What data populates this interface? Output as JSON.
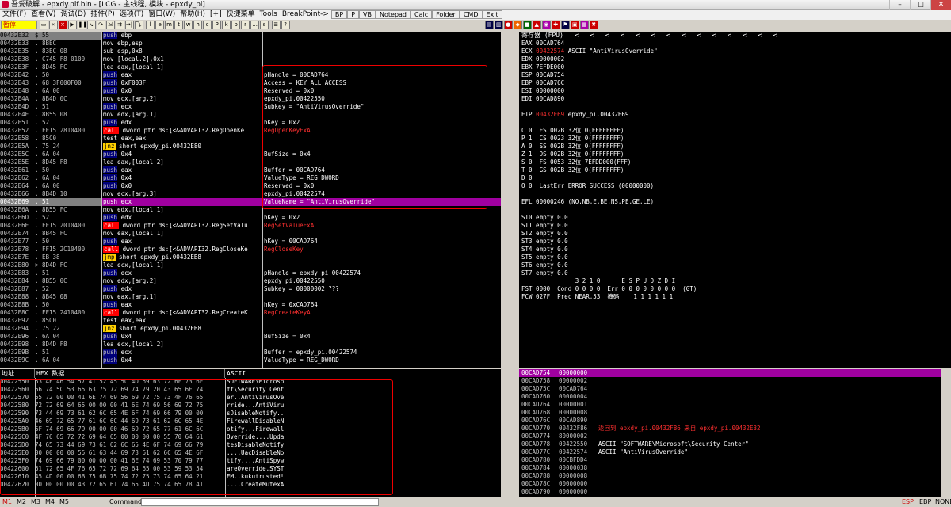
{
  "window": {
    "title": "吾爱破解 - epxdy.pif.bin - [LCG - 主线程, 模块 - epxdy_pi]",
    "min": "–",
    "max": "□",
    "close": "✕"
  },
  "menu": [
    "文件(F)",
    "查看(V)",
    "调试(D)",
    "插件(P)",
    "选项(T)",
    "窗口(W)",
    "帮助(H)",
    "[+]",
    "快捷菜单",
    "Tools",
    "BreakPoint->",
    "BP",
    "P",
    "VB",
    "Notepad",
    "Calc",
    "Folder",
    "CMD",
    "Exit"
  ],
  "toolbar": {
    "status": "暂停",
    "letters": [
      "l",
      "e",
      "m",
      "t",
      "w",
      "h",
      "c",
      "P",
      "k",
      "b",
      "r",
      "...",
      "s"
    ]
  },
  "cpu_rows": [
    {
      "addr": "00432E32",
      "mark": "$",
      "hex": "55",
      "op": "push",
      "arg": " ebp",
      "cmt": ""
    },
    {
      "addr": "00432E33",
      "mark": ".",
      "hex": "8BEC",
      "op": "mov",
      "arg": " ebp,esp",
      "cmt": ""
    },
    {
      "addr": "00432E35",
      "mark": ".",
      "hex": "83EC 08",
      "op": "sub",
      "arg": " esp,0x8",
      "cmt": ""
    },
    {
      "addr": "00432E38",
      "mark": ".",
      "hex": "C745 F8 0100",
      "op": "mov",
      "arg": " [local.2],0x1",
      "cmt": ""
    },
    {
      "addr": "00432E3F",
      "mark": ".",
      "hex": "8D45 FC",
      "op": "lea",
      "arg": " eax,[local.1]",
      "cmt": ""
    },
    {
      "addr": "00432E42",
      "mark": ".",
      "hex": "50",
      "op": "push",
      "arg": " eax",
      "cmt": "pHandle = 00CAD764"
    },
    {
      "addr": "00432E43",
      "mark": ".",
      "hex": "68 3F000F00",
      "op": "push",
      "arg": " 0xF003F",
      "cmt": "Access = KEY_ALL_ACCESS"
    },
    {
      "addr": "00432E48",
      "mark": ".",
      "hex": "6A 00",
      "op": "push",
      "arg": " 0x0",
      "cmt": "Reserved = 0x0"
    },
    {
      "addr": "00432E4A",
      "mark": ".",
      "hex": "8B4D 0C",
      "op": "mov",
      "arg": " ecx,[arg.2]",
      "cmt": "epxdy_pi.00422550"
    },
    {
      "addr": "00432E4D",
      "mark": ".",
      "hex": "51",
      "op": "push",
      "arg": " ecx",
      "cmt": "Subkey = \"AntiVirusOverride\""
    },
    {
      "addr": "00432E4E",
      "mark": ".",
      "hex": "8B55 08",
      "op": "mov",
      "arg": " edx,[arg.1]",
      "cmt": ""
    },
    {
      "addr": "00432E51",
      "mark": ".",
      "hex": "52",
      "op": "push",
      "arg": " edx",
      "cmt": "hKey = 0x2"
    },
    {
      "addr": "00432E52",
      "mark": ".",
      "hex": "FF15 2810400",
      "op": "call",
      "arg": " dword ptr ds:[<&ADVAPI32.RegOpenKe",
      "cmt": "RegOpenKeyExA"
    },
    {
      "addr": "00432E58",
      "mark": ".",
      "hex": "85C0",
      "op": "test",
      "arg": " eax,eax",
      "cmt": ""
    },
    {
      "addr": "00432E5A",
      "mark": ".",
      "hex": "75 24",
      "op": "jnz",
      "arg": " short epxdy_pi.00432E80",
      "cmt": ""
    },
    {
      "addr": "00432E5C",
      "mark": ".",
      "hex": "6A 04",
      "op": "push",
      "arg": " 0x4",
      "cmt": "BufSize = 0x4"
    },
    {
      "addr": "00432E5E",
      "mark": ".",
      "hex": "8D45 F8",
      "op": "lea",
      "arg": " eax,[local.2]",
      "cmt": ""
    },
    {
      "addr": "00432E61",
      "mark": ".",
      "hex": "50",
      "op": "push",
      "arg": " eax",
      "cmt": "Buffer = 00CAD764"
    },
    {
      "addr": "00432E62",
      "mark": ".",
      "hex": "6A 04",
      "op": "push",
      "arg": " 0x4",
      "cmt": "ValueType = REG_DWORD"
    },
    {
      "addr": "00432E64",
      "mark": ".",
      "hex": "6A 00",
      "op": "push",
      "arg": " 0x0",
      "cmt": "Reserved = 0x0"
    },
    {
      "addr": "00432E66",
      "mark": ".",
      "hex": "8B4D 10",
      "op": "mov",
      "arg": " ecx,[arg.3]",
      "cmt": "epxdy_pi.00422574"
    },
    {
      "addr": "00432E69",
      "mark": ".",
      "hex": "51",
      "op": "push",
      "arg": " ecx",
      "cmt": "ValueName = \"AntiVirusOverride\"",
      "hl": true
    },
    {
      "addr": "00432E6A",
      "mark": ".",
      "hex": "8B55 FC",
      "op": "mov",
      "arg": " edx,[local.1]",
      "cmt": ""
    },
    {
      "addr": "00432E6D",
      "mark": ".",
      "hex": "52",
      "op": "push",
      "arg": " edx",
      "cmt": "hKey = 0x2"
    },
    {
      "addr": "00432E6E",
      "mark": ".",
      "hex": "FF15 2010400",
      "op": "call",
      "arg": " dword ptr ds:[<&ADVAPI32.RegSetValu",
      "cmt": "RegSetValueExA"
    },
    {
      "addr": "00432E74",
      "mark": ".",
      "hex": "8B45 FC",
      "op": "mov",
      "arg": " eax,[local.1]",
      "cmt": ""
    },
    {
      "addr": "00432E77",
      "mark": ".",
      "hex": "50",
      "op": "push",
      "arg": " eax",
      "cmt": "hKey = 00CAD764"
    },
    {
      "addr": "00432E78",
      "mark": ".",
      "hex": "FF15 2C10400",
      "op": "call",
      "arg": " dword ptr ds:[<&ADVAPI32.RegCloseKe",
      "cmt": "RegCloseKey"
    },
    {
      "addr": "00432E7E",
      "mark": ".",
      "hex": "EB 38",
      "op": "jmp",
      "arg": " short epxdy_pi.00432EB8",
      "cmt": ""
    },
    {
      "addr": "00432E80",
      "mark": ">",
      "hex": "8D4D FC",
      "op": "lea",
      "arg": " ecx,[local.1]",
      "cmt": ""
    },
    {
      "addr": "00432E83",
      "mark": ".",
      "hex": "51",
      "op": "push",
      "arg": " ecx",
      "cmt": "pHandle = epxdy_pi.00422574"
    },
    {
      "addr": "00432E84",
      "mark": ".",
      "hex": "8B55 0C",
      "op": "mov",
      "arg": " edx,[arg.2]",
      "cmt": "epxdy_pi.00422550"
    },
    {
      "addr": "00432E87",
      "mark": ".",
      "hex": "52",
      "op": "push",
      "arg": " edx",
      "cmt": "Subkey = 00000002 ???"
    },
    {
      "addr": "00432E88",
      "mark": ".",
      "hex": "8B45 08",
      "op": "mov",
      "arg": " eax,[arg.1]",
      "cmt": ""
    },
    {
      "addr": "00432E8B",
      "mark": ".",
      "hex": "50",
      "op": "push",
      "arg": " eax",
      "cmt": "hKey = 0xCAD764"
    },
    {
      "addr": "00432E8C",
      "mark": ".",
      "hex": "FF15 2410400",
      "op": "call",
      "arg": " dword ptr ds:[<&ADVAPI32.RegCreateK",
      "cmt": "RegCreateKeyA"
    },
    {
      "addr": "00432E92",
      "mark": ".",
      "hex": "85C0",
      "op": "test",
      "arg": " eax,eax",
      "cmt": ""
    },
    {
      "addr": "00432E94",
      "mark": ".",
      "hex": "75 22",
      "op": "jnz",
      "arg": " short epxdy_pi.00432EB8",
      "cmt": ""
    },
    {
      "addr": "00432E96",
      "mark": ".",
      "hex": "6A 04",
      "op": "push",
      "arg": " 0x4",
      "cmt": "BufSize = 0x4"
    },
    {
      "addr": "00432E98",
      "mark": ".",
      "hex": "8D4D F8",
      "op": "lea",
      "arg": " ecx,[local.2]",
      "cmt": ""
    },
    {
      "addr": "00432E9B",
      "mark": ".",
      "hex": "51",
      "op": "push",
      "arg": " ecx",
      "cmt": "Buffer = epxdy_pi.00422574"
    },
    {
      "addr": "00432E9C",
      "mark": ".",
      "hex": "6A 04",
      "op": "push",
      "arg": " 0x4",
      "cmt": "ValueType = REG_DWORD"
    }
  ],
  "registers": {
    "header": "寄存器 (FPU)",
    "lines": [
      [
        "EAX 00CAD764",
        ""
      ],
      [
        "ECX ",
        "00422574",
        " ASCII \"AntiVirusOverride\""
      ],
      [
        "EDX 00000002",
        ""
      ],
      [
        "EBX 7EFDE000",
        ""
      ],
      [
        "ESP 00CAD754",
        ""
      ],
      [
        "EBP 00CAD76C",
        ""
      ],
      [
        "ESI 00000000",
        ""
      ],
      [
        "EDI 00CAD890",
        ""
      ],
      [
        "",
        ""
      ],
      [
        "EIP ",
        "00432E69",
        " epxdy_pi.00432E69"
      ],
      [
        "",
        ""
      ],
      [
        "C 0  ES 002B 32位 0(FFFFFFFF)",
        ""
      ],
      [
        "P 1  CS 0023 32位 0(FFFFFFFF)",
        ""
      ],
      [
        "A 0  SS 002B 32位 0(FFFFFFFF)",
        ""
      ],
      [
        "Z 1  DS 002B 32位 0(FFFFFFFF)",
        ""
      ],
      [
        "S 0  FS 0053 32位 7EFDD000(FFF)",
        ""
      ],
      [
        "T 0  GS 002B 32位 0(FFFFFFFF)",
        ""
      ],
      [
        "D 0",
        ""
      ],
      [
        "O 0  LastErr ERROR_SUCCESS (00000000)",
        ""
      ],
      [
        "",
        ""
      ],
      [
        "EFL 00000246 (NO,NB,E,BE,NS,PE,GE,LE)",
        ""
      ],
      [
        "",
        ""
      ],
      [
        "ST0 empty 0.0",
        ""
      ],
      [
        "ST1 empty 0.0",
        ""
      ],
      [
        "ST2 empty 0.0",
        ""
      ],
      [
        "ST3 empty 0.0",
        ""
      ],
      [
        "ST4 empty 0.0",
        ""
      ],
      [
        "ST5 empty 0.0",
        ""
      ],
      [
        "ST6 empty 0.0",
        ""
      ],
      [
        "ST7 empty 0.0",
        ""
      ],
      [
        "               3 2 1 0      E S P U O Z D I",
        ""
      ],
      [
        "FST 0000  Cond 0 0 0 0  Err 0 0 0 0 0 0 0 0  (GT)",
        ""
      ],
      [
        "FCW 027F  Prec NEAR,53  掩码    1 1 1 1 1 1",
        ""
      ]
    ]
  },
  "dump": {
    "headers": [
      "地址",
      "HEX 数据",
      "ASCII"
    ],
    "rows": [
      [
        "00422550",
        "53 4F 46 54 57 41 52 45 5C 4D 69 63 72 6F 73 6F",
        "SOFTWARE\\Microso"
      ],
      [
        "00422560",
        "66 74 5C 53 65 63 75 72 69 74 79 20 43 65 6E 74",
        "ft\\Security Cent"
      ],
      [
        "00422570",
        "65 72 00 00 41 6E 74 69 56 69 72 75 73 4F 76 65",
        "er..AntiVirusOve"
      ],
      [
        "00422580",
        "72 72 69 64 65 00 00 00 41 6E 74 69 56 69 72 75",
        "rride...AntiViru"
      ],
      [
        "00422590",
        "73 44 69 73 61 62 6C 65 4E 6F 74 69 66 79 00 00",
        "sDisableNotify.."
      ],
      [
        "004225A0",
        "46 69 72 65 77 61 6C 6C 44 69 73 61 62 6C 65 4E",
        "FirewallDisableN"
      ],
      [
        "004225B0",
        "6F 74 69 66 79 00 00 00 46 69 72 65 77 61 6C 6C",
        "otify...Firewall"
      ],
      [
        "004225C0",
        "4F 76 65 72 72 69 64 65 00 00 00 00 55 70 64 61",
        "Override....Upda"
      ],
      [
        "004225D0",
        "74 65 73 44 69 73 61 62 6C 65 4E 6F 74 69 66 79",
        "tesDisableNotify"
      ],
      [
        "004225E0",
        "00 00 00 00 55 61 63 44 69 73 61 62 6C 65 4E 6F",
        "....UacDisableNo"
      ],
      [
        "004225F0",
        "74 69 66 79 00 00 00 00 41 6E 74 69 53 70 79 77",
        "tify....AntiSpyw"
      ],
      [
        "00422600",
        "61 72 65 4F 76 65 72 72 69 64 65 00 53 59 53 54",
        "areOverride.SYST"
      ],
      [
        "00422610",
        "45 4D 00 00 6B 75 6B 75 74 72 75 73 74 65 64 21",
        "EM..kukutrusted!"
      ],
      [
        "00422620",
        "00 00 00 00 43 72 65 61 74 65 4D 75 74 65 78 41",
        "....CreateMutexA"
      ]
    ]
  },
  "stack": {
    "rows": [
      [
        "00CAD754",
        "00000000",
        ""
      ],
      [
        "00CAD758",
        "00000002",
        ""
      ],
      [
        "00CAD75C",
        "00CAD764",
        ""
      ],
      [
        "00CAD760",
        "00000004",
        ""
      ],
      [
        "00CAD764",
        "00000001",
        ""
      ],
      [
        "00CAD768",
        "00000008",
        ""
      ],
      [
        "00CAD76C",
        "00CAD890",
        ""
      ],
      [
        "00CAD770",
        "00432F86",
        "返回到 epxdy_pi.00432F86 来自 epxdy_pi.00432E32"
      ],
      [
        "00CAD774",
        "80000002",
        ""
      ],
      [
        "00CAD778",
        "00422550",
        "ASCII \"SOFTWARE\\Microsoft\\Security Center\""
      ],
      [
        "00CAD77C",
        "00422574",
        "ASCII \"AntiVirusOverride\""
      ],
      [
        "00CAD780",
        "00CBFDD4",
        ""
      ],
      [
        "00CAD784",
        "00000038",
        ""
      ],
      [
        "00CAD788",
        "00000008",
        ""
      ],
      [
        "00CAD78C",
        "00000000",
        ""
      ],
      [
        "00CAD790",
        "00000000",
        ""
      ]
    ]
  },
  "status": {
    "tabs": [
      "M1",
      "M2",
      "M3",
      "M4",
      "M5"
    ],
    "command_label": "Command:",
    "right": [
      "ESP",
      "EBP",
      "NONE"
    ]
  }
}
